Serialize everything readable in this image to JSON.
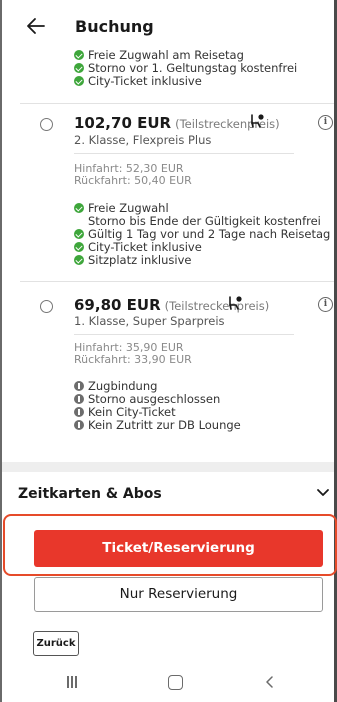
{
  "header": {
    "title": "Buchung"
  },
  "top_features": [
    "Freie Zugwahl am Reisetag",
    "Storno vor 1. Geltungstag kostenfrei",
    "City-Ticket inklusive"
  ],
  "offers": [
    {
      "price": "102,70 EUR",
      "partial": "(Teilstreckenpreis)",
      "class_line": "2. Klasse,  Flexpreis Plus",
      "outbound": "Hinfahrt: 52,30 EUR",
      "return": "Rückfahrt: 50,40 EUR",
      "features": [
        {
          "icon": "check",
          "text": "Freie Zugwahl"
        },
        {
          "icon": "none",
          "text": "Storno bis Ende der Gültigkeit kostenfrei"
        },
        {
          "icon": "check",
          "text": "Gültig 1 Tag vor und 2 Tage nach Reisetag"
        },
        {
          "icon": "check",
          "text": "City-Ticket inklusive"
        },
        {
          "icon": "check",
          "text": "Sitzplatz inklusive"
        }
      ]
    },
    {
      "price": "69,80 EUR",
      "partial": "(Teilstreckenpreis)",
      "class_line": "1. Klasse,  Super Sparpreis",
      "outbound": "Hinfahrt: 35,90 EUR",
      "return": "Rückfahrt: 33,90 EUR",
      "features": [
        {
          "icon": "info",
          "text": "Zugbindung"
        },
        {
          "icon": "info",
          "text": "Storno ausgeschlossen"
        },
        {
          "icon": "info",
          "text": "Kein City-Ticket"
        },
        {
          "icon": "info",
          "text": "Kein Zutritt zur DB Lounge"
        }
      ]
    }
  ],
  "sections": {
    "zeitkarten": "Zeitkarten & Abos"
  },
  "buttons": {
    "primary": "Ticket/Reservierung",
    "secondary": "Nur Reservierung",
    "back": "Zurück"
  },
  "colors": {
    "primary": "#e8372b",
    "highlight": "#e64b2a",
    "check": "#3ea63b"
  }
}
